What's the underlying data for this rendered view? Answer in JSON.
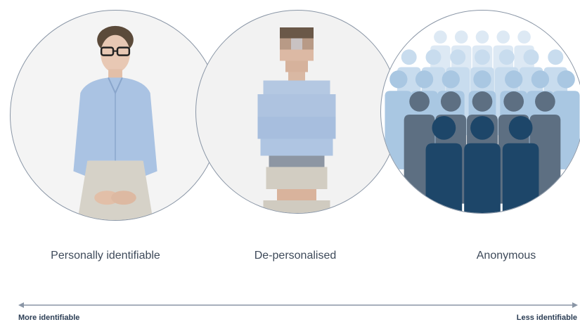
{
  "panels": [
    {
      "label": "Personally identifiable",
      "icon": "person-photo"
    },
    {
      "label": "De-personalised",
      "icon": "pixelated-person"
    },
    {
      "label": "Anonymous",
      "icon": "crowd-silhouettes"
    }
  ],
  "axis": {
    "left_label": "More identifiable",
    "right_label": "Less identifiable",
    "direction": "bidirectional"
  },
  "colors": {
    "circle_border": "#8a96a6",
    "axis_line": "#8a96a6",
    "label_text": "#3e4a5a",
    "axis_text": "#2c3e55",
    "crowd_dark": "#1d4669",
    "crowd_mid": "#5d6f82",
    "crowd_light": "#a9c7e2",
    "shirt": "#aac3e3",
    "skirt": "#d6d2c8"
  }
}
